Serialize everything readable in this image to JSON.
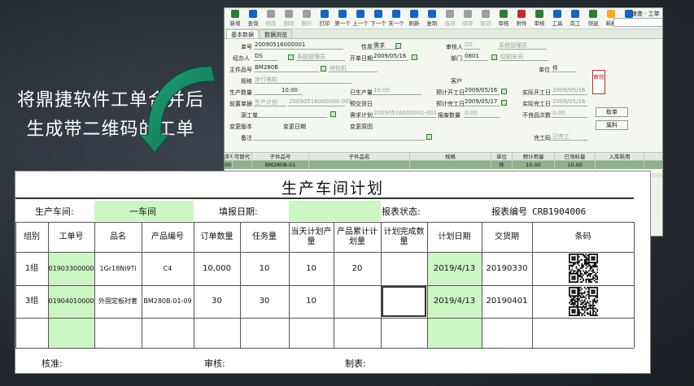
{
  "caption": {
    "line1": "将鼎捷软件工单合并后",
    "line2": "生成带二维码的工单"
  },
  "erp": {
    "toolbar": [
      {
        "label": "新增",
        "color": "#2e7d32",
        "enabled": true
      },
      {
        "label": "查询",
        "color": "#1565c0",
        "enabled": true
      },
      {
        "label": "修改",
        "color": "#9e9e9e",
        "enabled": false
      },
      {
        "label": "删除",
        "color": "#9e9e9e",
        "enabled": false
      },
      {
        "label": "删行",
        "color": "#9e9e9e",
        "enabled": false
      },
      {
        "label": "打印",
        "color": "#1565c0",
        "enabled": true
      },
      {
        "label": "第一个",
        "color": "#1565c0",
        "enabled": true
      },
      {
        "label": "上一个",
        "color": "#1565c0",
        "enabled": true
      },
      {
        "label": "下一个",
        "color": "#1565c0",
        "enabled": true
      },
      {
        "label": "末一个",
        "color": "#1565c0",
        "enabled": true
      },
      {
        "label": "刷新",
        "color": "#1565c0",
        "enabled": true
      },
      {
        "label": "复制",
        "color": "#1565c0",
        "enabled": true
      },
      {
        "label": "选项",
        "color": "#9e9e9e",
        "enabled": false
      },
      {
        "label": "保存",
        "color": "#9e9e9e",
        "enabled": false
      },
      {
        "label": "取消",
        "color": "#9e9e9e",
        "enabled": false
      },
      {
        "label": "审核",
        "color": "#2e7d32",
        "enabled": true
      },
      {
        "label": "附件",
        "color": "#c62828",
        "enabled": true
      },
      {
        "label": "审核",
        "color": "#2e7d32",
        "enabled": true
      },
      {
        "label": "工具",
        "color": "#1565c0",
        "enabled": true
      },
      {
        "label": "完工",
        "color": "#1565c0",
        "enabled": true
      },
      {
        "label": "领退",
        "color": "#2e7d32",
        "enabled": true
      },
      {
        "label": "耗料",
        "color": "#f9a825",
        "enabled": true
      },
      {
        "label": "条码",
        "color": "#1565c0",
        "enabled": true
      }
    ],
    "search_label": "速查 · 工单",
    "tabs": [
      "基本数据",
      "数据浏览"
    ],
    "fields": {
      "order_no_label": "单号",
      "order_no": "20090516000001",
      "nature_label": "性质",
      "nature": "需求",
      "auditor_label": "审核人",
      "auditor": "DS",
      "auditor_role": "系统管理员",
      "handler_label": "经办人",
      "handler": "DS",
      "handler_role": "系统管理员",
      "open_date_label": "开单日期",
      "open_date": "2009/05/16",
      "dept_label": "部门",
      "dept": "0801",
      "dept_name": "切割车间",
      "part_label": "主件品号",
      "part": "BM280B",
      "part_name": "块包机",
      "unit_label": "单位",
      "unit": "件",
      "spec_label": "规格",
      "spec": "步行电机",
      "customer_label": "客户",
      "qty_label": "生产数量",
      "qty": "10.00",
      "produced_label": "已生产量",
      "produced": "10.00",
      "plan_start_label": "预计开工日",
      "plan_start": "2009/05/16",
      "actual_start_label": "实际开工日",
      "actual_start": "2009/05/16",
      "pre_order_label": "前置单据",
      "pre_order_type": "生产计划",
      "pre_order": "20090516000000 001",
      "plan_finish_label": "预交货日",
      "plan_end_label": "预计完工日",
      "plan_end": "2009/05/17",
      "actual_end_label": "实际完工日",
      "actual_end": "2009/05/16",
      "source_label": "源工单",
      "demand_label": "需求计划",
      "demand": "20090516000001-001",
      "scrap_label": "报废数量",
      "scrap": "0.00",
      "defect_label": "不良品次数",
      "defect": "0.00",
      "change_ver_label": "变更版本",
      "change_date_label": "变更日期",
      "change_reason_label": "变更原因",
      "remark_label": "备注",
      "finish_code_label": "完工码",
      "finish_code": "已完工",
      "stamp": "审核",
      "btn_return": "取单",
      "btn_material": "属料"
    },
    "grid": {
      "headers": [
        "序号",
        "可替代",
        "子件品号",
        "子件品名",
        "规格",
        "单位",
        "预计用量",
        "已领料量",
        "入库耗用"
      ],
      "rows": [
        [
          "001",
          "",
          "BM280B-01",
          "",
          "",
          "件",
          "10.00",
          "10.00",
          ""
        ]
      ]
    }
  },
  "plan": {
    "title": "生产车间计划",
    "workshop_label": "生产车间:",
    "workshop": "一车间",
    "fill_date_label": "填报日期:",
    "status_label": "报表状态:",
    "report_no_label": "报表编号",
    "report_no": "CRB1904006",
    "headers": [
      "组别",
      "工单号",
      "品名",
      "产品编号",
      "订单数量",
      "任务量",
      "当天计划产量",
      "产品累计计划量",
      "计划完成数量",
      "计划日期",
      "交货期",
      "条码"
    ],
    "rows": [
      [
        "1组",
        "2019033000000",
        "1Gr18Ni9Ti",
        "C4",
        "10,000",
        "10",
        "10",
        "20",
        "",
        "2019/4/13",
        "20190330"
      ],
      [
        "3组",
        "2019040100000",
        "外固定板衬套",
        "BM280B-01-09",
        "30",
        "30",
        "10",
        "",
        "",
        "2019/4/13",
        "20190401"
      ]
    ],
    "footer": {
      "approve": "核准:",
      "review": "审核:",
      "maker": "制表:"
    }
  }
}
